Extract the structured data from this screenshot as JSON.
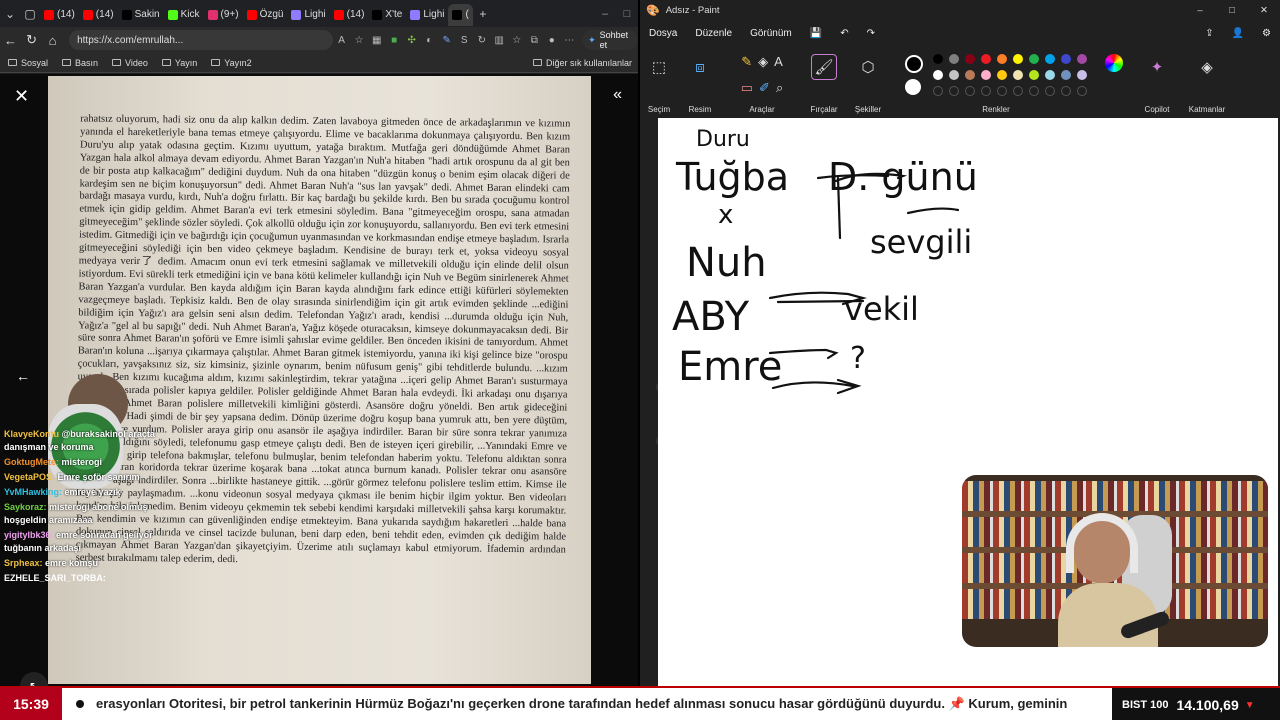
{
  "browser": {
    "tabs": [
      {
        "label": "(14)",
        "color": "#ff0000"
      },
      {
        "label": "(14)",
        "color": "#ff0000"
      },
      {
        "label": "Sakin",
        "color": "#000000"
      },
      {
        "label": "Kick",
        "color": "#53fc18"
      },
      {
        "label": "(9+)",
        "color": "#e1306c"
      },
      {
        "label": "Özgü",
        "color": "#ff0000"
      },
      {
        "label": "Lighi",
        "color": "#8e7bff"
      },
      {
        "label": "(14)",
        "color": "#ff0000"
      },
      {
        "label": "X'te",
        "color": "#000000"
      },
      {
        "label": "Lighi",
        "color": "#8e7bff"
      },
      {
        "label": "(",
        "color": "#000000"
      }
    ],
    "url": "https://x.com/emrullah...",
    "sohbet_label": "Sohbet et",
    "bookmarks": [
      "Sosyal",
      "Basın",
      "Video",
      "Yayın",
      "Yayın2"
    ],
    "other_bookmarks": "Diğer sık kullanılanlar"
  },
  "document": {
    "text": "rahatsız oluyorum, hadi siz onu da alıp kalkın dedim. Zaten lavaboya gitmeden önce de arkadaşlarımın ve kızımın yanında el hareketleriyle bana temas etmeye çalışıyordu. Elime ve bacaklarıma dokunmaya çalışıyordu. Ben kızım Duru'yu alıp yatak odasına geçtim. Kızımı uyuttum, yatağa bıraktım. Mutfağa geri döndüğümde Ahmet Baran Yazgan hala alkol almaya devam ediyordu. Ahmet Baran Yazgan'ın Nuh'a hitaben \"hadi artık orospunu da al git ben de bir posta atıp kalkacağım\" dediğini duydum. Nuh da ona hitaben \"düzgün konuş o benim eşim olacak diğeri de kardeşim sen ne biçim konuşuyorsun\" dedi. Ahmet Baran Nuh'a \"sus lan yavşak\" dedi. Ahmet Baran elindeki cam bardağı masaya vurdu, kırdı, Nuh'a doğru fırlattı. Bir kaç bardağı bu şekilde kırdı. Ben bu sırada çocuğumu kontrol etmek için gidip geldim. Ahmet Baran'a evi terk etmesini söyledim. Bana \"gitmeyeceğim orospu, sana atmadan gitmeyeceğim\" şeklinde sözler söyledi. Çok alkollü olduğu için zor konuşuyordu, sallanıyordu. Ben evi terk etmesini istedim. Gitmediği için ve bağırdığı için çocuğumun uyanmasından ve korkmasından endişe etmeye başladım. Israrla gitmeyeceğini söylediği için ben video çekmeye başladım. Kendisine de burayı terk et, yoksa videoyu sosyal medyaya verir了 dedim. Amacım onun evi terk etmesini sağlamak ve milletvekili olduğu için elinde delil olsun istiyordum. Evi sürekli terk etmediğini için ve bana kötü kelimeler kullandığı için Nuh ve Begüm sinirlenerek Ahmet Baran Yazgan'a vurdular. Ben kayda aldığım için Baran kayda alındığını fark edince ettiği küfürleri söylemekten vazgeçmeye başladı. Tepkisiz kaldı. Ben de olay sırasında sinirlendiğim için git artık evimden şeklinde ...ediğini bildiğim için Yağız'ı ara gelsin seni alsın dedim. Telefondan Yağız'ı aradı, kendisi ...durumda olduğu için Nuh, Yağız'a \"gel al bu sapığı\" dedi. Nuh Ahmet Baran'a, Yağız köşede oturacaksın, kimseye dokunmayacaksın dedi. Bir süre sonra Ahmet Baran'ın şoförü ve Emre isimli şahıslar evime geldiler. Ben önceden ikisini de tanıyordum. Ahmet Baran'ın koluna ...işarıya çıkarmaya çalıştılar. Ahmet Baran gitmek istemiyordu, yanına iki kişi gelince bize \"orospu çocukları, yavşaksınız siz, siz kimsiniz, şizinle oynarım, benim nüfusum geniş\" gibi tehditlerde bulundu. ...kızım uyandı. Ben kızımı kucağıma aldım, kızımı sakinleştirdim, tekrar yatağına ...içeri gelip Ahmet Baran'ı susturmaya çalıştı. Bu sırada polisler kapıya geldiler. Polisler geldiğinde Ahmet Baran hala evdeydi. İki arkadaşı onu dışarıya çıkardılar. Ahmet Baran polislere milletvekili kimliğini gösterdi. Asansöre doğru yöneldi. Ben artık gideceğini düşündüm. Hadi şimdi de bir şey yapsana dedim. Dönüp üzerime doğru koşup bana yumruk attı, ben yere düştüm, kafamı yere vurdum. Polisler araya girip onu asansör ile aşağıya indirdiler. Baran bir süre sonra tekrar yanımıza ...evden kaldığını söyledi, telefonumu gasp etmeye çalıştı dedi. Ben de isteyen içeri girebilir, ...Yanındaki Emre ve Yağız içeri girip telefona bakmışlar, telefonu bulmuşlar, benim telefondan haberim yoktu. Telefonu aldıktan sonra Ahmet Baran koridorda tekrar üzerime koşarak bana ...tokat atınca burnum kanadı. Polisler tekrar onu asansöre bindirip aşağı indirdiler. Sonra ...birlikte hastaneye gittik. ...görür görmez telefonu polislere teslim ettim. Kimse ile hiç bir şey paylaşmadım. ...konu videonun sosyal medyaya çıkması ile benim hiçbir ilgim yoktur. Ben videoları kendim bile izlemedim. Benim videoyu çekmemin tek sebebi kendimi karşıdaki milletvekili şahsa karşı korumaktır. Ben kendimin ve kızımın can güvenliğinden endişe etmekteyim. Bana yukarıda saydığım hakaretleri ...halde bana dokunup cinsel saldırıda ve cinsel tacizde bulunan, beni darp eden, beni tehdit eden, evimden çık dediğim halde çıkmayan Ahmet Baran Yazgan'dan şikayetçiyim. Üzerime atılı suçlamayı kabul etmiyorum. İfademin ardından serbest bırakılmamı talep ederim, dedi."
  },
  "chat": [
    {
      "user": "KlavyeKontu",
      "user_color": "#f0c040",
      "msg": "@buraksakinol araçta danışman ve koruma"
    },
    {
      "user": "GoktugMete:",
      "user_color": "#f09030",
      "msg": "misterogi"
    },
    {
      "user": "VegetaPOS:",
      "user_color": "#f0c040",
      "msg": "Emre şoför sanırım"
    },
    {
      "user": "YvMHawking:",
      "user_color": "#30c0e0",
      "msg": "emreye yazık"
    },
    {
      "user": "Saykoraz:",
      "user_color": "#70d040",
      "msg": "misterogi abone olmuş hoşgeldin aramızaaa"
    },
    {
      "user": "yigitylbk36:",
      "user_color": "#f0a0f0",
      "msg": "emre sonradan geliyor tuğbanın arkadaşı"
    },
    {
      "user": "Srpheax:",
      "user_color": "#f0c040",
      "msg": "emre komşu"
    },
    {
      "user": "EZHELE_SARI_TORBA:",
      "user_color": "#ffffff",
      "msg": ""
    }
  ],
  "paint": {
    "title": "Adsız - Paint",
    "menu": [
      "Dosya",
      "Düzenle",
      "Görünüm"
    ],
    "groups": [
      "Seçim",
      "Resim",
      "Araçlar",
      "Fırçalar",
      "Şekiller",
      "Renkler",
      "Copilot",
      "Katmanlar"
    ],
    "palette": [
      "#000000",
      "#7f7f7f",
      "#880015",
      "#ed1c24",
      "#ff7f27",
      "#fff200",
      "#22b14c",
      "#00a2e8",
      "#3f48cc",
      "#a349a4",
      "#ffffff",
      "#c3c3c3",
      "#b97a57",
      "#ffaec9",
      "#ffc90e",
      "#efe4b0",
      "#b5e61d",
      "#99d9ea",
      "#7092be",
      "#c8bfe7"
    ],
    "handwriting": {
      "top": "Duru",
      "row1_left": "Tuğba",
      "row1_right": "D. günü",
      "x_mark": "x",
      "row2_left": "Nuh",
      "row2_right": "sevgili",
      "row3_left": "ABY",
      "row3_right": "vekil",
      "row4_left": "Emre",
      "row4_right": "?"
    }
  },
  "ticker": {
    "time": "15:39",
    "news": "erasyonları Otoritesi, bir petrol tankerinin Hürmüz Boğazı'nı geçerken drone tarafından hedef alınması sonucu hasar gördüğünü duyurdu. 📌 Kurum, geminin",
    "bist_label": "BIST 100",
    "bist_value": "14.100,69",
    "bist_dir": "▼"
  }
}
